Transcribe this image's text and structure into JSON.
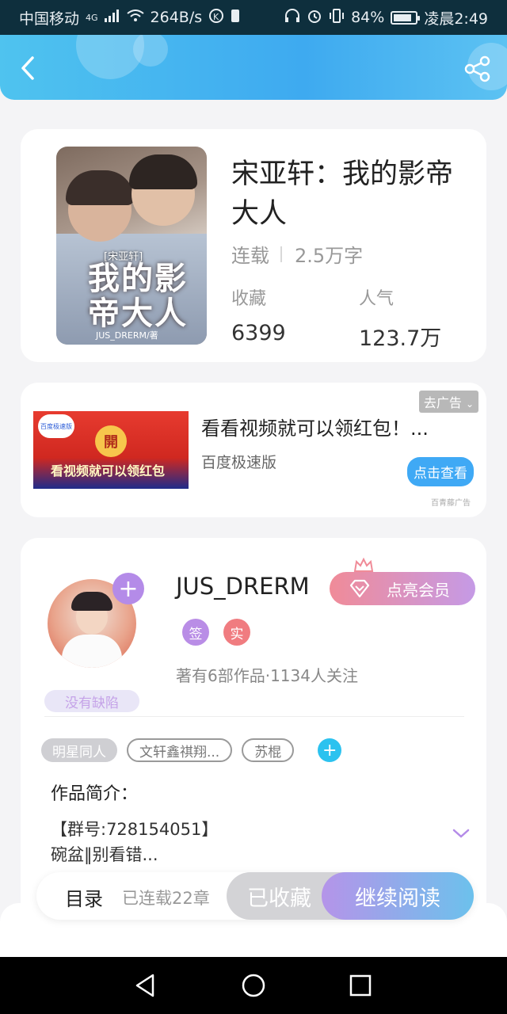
{
  "status_bar": {
    "carrier": "中国移动",
    "network": "4G",
    "speed": "264B/s",
    "battery": "84%",
    "battery_level": 0.84,
    "time": "凌晨2:49"
  },
  "book": {
    "title": "宋亚轩：我的影帝大人",
    "status": "连载",
    "word_count": "2.5万字",
    "favorites_label": "收藏",
    "favorites_value": "6399",
    "popularity_label": "人气",
    "popularity_value": "123.7万",
    "cover_small": "[宋亚轩]",
    "cover_title_line1": "我的影",
    "cover_title_line2": "帝大人",
    "cover_author": "JUS_DRERM/著"
  },
  "ad": {
    "title": "看看视频就可以领红包！...",
    "source": "百度极速版",
    "close_label": "去广告",
    "cta_label": "点击查看",
    "mark": "百青藤广告",
    "image_coin": "開",
    "image_text": "看视频就可以领红包"
  },
  "author": {
    "name": "JUS_DRERM",
    "vip_label": "点亮会员",
    "badge_sign": "签",
    "badge_real": "实",
    "stats": "著有6部作品·1134人关注",
    "defect_label": "没有缺陷"
  },
  "tags": [
    "明星同人",
    "文轩鑫祺翔...",
    "苏棍"
  ],
  "intro": {
    "title": "作品简介：",
    "text_line1": "【群号:728154051】",
    "text_line2": "碗盆‖别看错..."
  },
  "actions": {
    "toc": "目录",
    "chapters": "已连载22章",
    "collected": "已收藏",
    "continue": "继续阅读"
  },
  "colors": {
    "header_start": "#4fc3ef",
    "header_end": "#3eaaf0",
    "accent_purple": "#b48be8",
    "accent_blue": "#2cc2ef"
  }
}
